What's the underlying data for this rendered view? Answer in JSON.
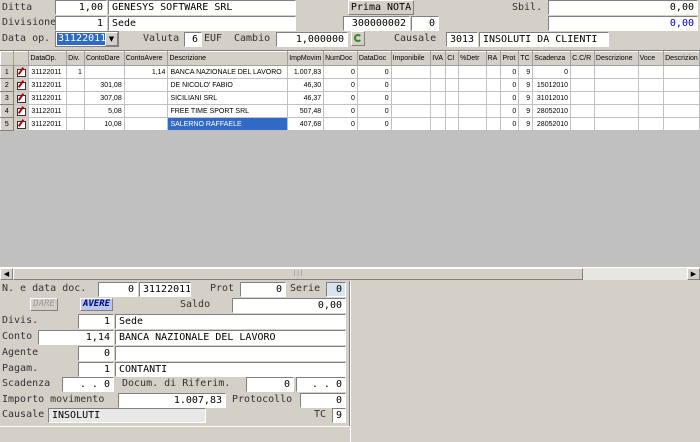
{
  "header": {
    "ditta_label": "Ditta",
    "ditta_num": "1,00",
    "ditta_name": "GENESYS SOFTWARE SRL",
    "prima_nota_label": "Prima NOTA",
    "sbil_label": "Sbil.",
    "sbil_value": "0,00",
    "sbil_value2": "0,00",
    "divisione_label": "Divisione",
    "divisione_num": "1",
    "divisione_name": "Sede",
    "doc_code": "300000002",
    "doc_count": "0",
    "data_op_label": "Data op.",
    "data_op_value": "31122011",
    "valuta_label": "Valuta",
    "valuta_num": "6",
    "valuta_code": "EUF",
    "cambio_label": "Cambio",
    "cambio_value": "1,000000",
    "causale_label": "Causale",
    "causale_code": "3013",
    "causale_desc": "INSOLUTI DA CLIENTI"
  },
  "grid": {
    "columns": [
      "DataOp.",
      "Div.",
      "ContoDare",
      "ContoAvere",
      "Descrizione",
      "ImpMovim",
      "NumDoc",
      "DataDoc",
      "Imponibile",
      "IVA",
      "CI",
      "%Detr",
      "RA",
      "Prot",
      "TC",
      "Scadenza",
      "C.C/R",
      "Descrizione",
      "Voce",
      "Descrizion"
    ],
    "rows": [
      {
        "n": "1",
        "data": "31122011",
        "div": "1",
        "dare": "",
        "avere": "1,14",
        "desc": "BANCA NAZIONALE DEL LAVORO",
        "imp": "1.007,83",
        "numdoc": "0",
        "datadoc": "0",
        "prot": "0",
        "tc": "9",
        "scad": "0"
      },
      {
        "n": "2",
        "data": "31122011",
        "div": "",
        "dare": "301,08",
        "avere": "",
        "desc": "DE NICOLO' FABIO",
        "imp": "46,30",
        "numdoc": "0",
        "datadoc": "0",
        "prot": "0",
        "tc": "9",
        "scad": "15012010"
      },
      {
        "n": "3",
        "data": "31122011",
        "div": "",
        "dare": "307,08",
        "avere": "",
        "desc": "SICILIANI SRL",
        "imp": "46,37",
        "numdoc": "0",
        "datadoc": "0",
        "prot": "0",
        "tc": "9",
        "scad": "31012010"
      },
      {
        "n": "4",
        "data": "31122011",
        "div": "",
        "dare": "5,08",
        "avere": "",
        "desc": "FREE TIME SPORT SRL",
        "imp": "507,48",
        "numdoc": "0",
        "datadoc": "0",
        "prot": "0",
        "tc": "9",
        "scad": "28052010"
      },
      {
        "n": "5",
        "data": "31122011",
        "div": "",
        "dare": "10,08",
        "avere": "",
        "desc": "SALERNO RAFFAELE",
        "imp": "407,68",
        "numdoc": "0",
        "datadoc": "0",
        "prot": "0",
        "tc": "9",
        "scad": "28052010"
      }
    ]
  },
  "detail": {
    "ndata_label": "N. e data doc.",
    "ndata_num": "0",
    "ndata_date": "31122011",
    "prot_label": "Prot",
    "prot_value": "0",
    "serie_label": "Serie",
    "serie_value": "0",
    "dare_btn": "DARE",
    "avere_btn": "AVERE",
    "saldo_label": "Saldo",
    "saldo_value": "0,00",
    "divis_label": "Divis.",
    "divis_num": "1",
    "divis_name": "Sede",
    "conto_label": "Conto",
    "conto_num": "1,14",
    "conto_name": "BANCA NAZIONALE DEL LAVORO",
    "agente_label": "Agente",
    "agente_num": "0",
    "pagam_label": "Pagam.",
    "pagam_num": "1",
    "pagam_name": "CONTANTI",
    "scadenza_label": "Scadenza",
    "scadenza_value": ". . 0",
    "docum_label": "Docum. di Riferim.",
    "docum_num": "0",
    "docum_date": ". . 0",
    "importo_label": "Importo movimento",
    "importo_value": "1.007,83",
    "protocollo_label": "Protocollo",
    "protocollo_value": "0",
    "causale_label": "Causale",
    "causale_value": "INSOLUTI",
    "tc_label": "TC",
    "tc_value": "9"
  },
  "icons": {
    "dropdown": "chevron-down-icon",
    "refresh": "refresh-icon",
    "edit": "edit-row-icon"
  },
  "colors": {
    "selection": "#316ac5",
    "face": "#d4d0c8",
    "accent_blue": "#0000cc"
  }
}
